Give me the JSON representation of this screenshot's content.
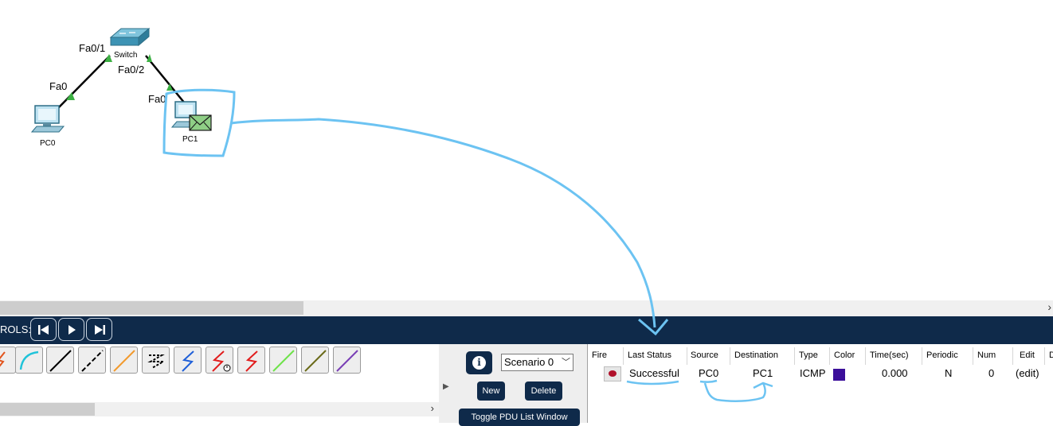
{
  "topology": {
    "switch_label": "Switch",
    "pc0_label": "PC0",
    "pc1_label": "PC1",
    "ports": {
      "sw_fa01": "Fa0/1",
      "sw_fa02": "Fa0/2",
      "pc0_fa0": "Fa0",
      "pc1_fa0": "Fa0"
    }
  },
  "controls": {
    "label": "ROLS:",
    "buttons": [
      "step-back-icon",
      "play-icon",
      "step-forward-icon"
    ]
  },
  "cables": {
    "icons": [
      "console-cable-icon",
      "straight-through-cable-icon",
      "crossover-cable-icon",
      "fiber-cable-icon",
      "phone-cable-icon",
      "coaxial-cable-icon",
      "serial-dce-cable-icon",
      "serial-dte-cable-icon",
      "octal-cable-icon",
      "iot-cable-icon",
      "usb-cable-icon"
    ]
  },
  "scenario": {
    "info": "i",
    "selected": "Scenario 0",
    "new_label": "New",
    "delete_label": "Delete",
    "toggle_label": "Toggle PDU List Window"
  },
  "pdu_table": {
    "headers": {
      "fire": "Fire",
      "last_status": "Last Status",
      "source": "Source",
      "destination": "Destination",
      "type": "Type",
      "color": "Color",
      "time": "Time(sec)",
      "periodic": "Periodic",
      "num": "Num",
      "edit": "Edit",
      "delete": "D"
    },
    "row": {
      "last_status": "Successful",
      "source": "PC0",
      "destination": "PC1",
      "type": "ICMP",
      "color": "#3b0f9a",
      "time": "0.000",
      "periodic": "N",
      "num": "0",
      "edit": "(edit)"
    }
  },
  "colors": {
    "toolbar": "#0f2a4a",
    "annotation": "#6cc3f2",
    "link_up": "#3cb043"
  }
}
